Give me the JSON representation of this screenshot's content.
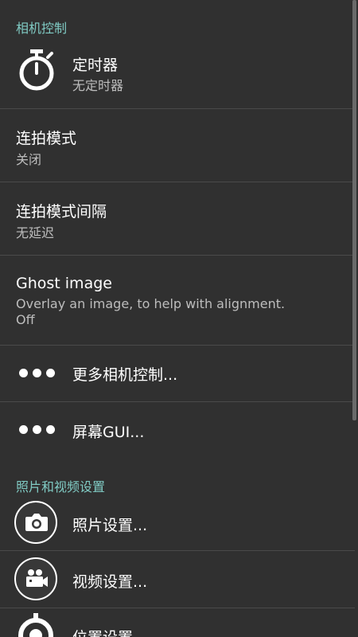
{
  "sections": {
    "camera_controls": "相机控制",
    "photo_video": "照片和视频设置"
  },
  "prefs": {
    "timer": {
      "title": "定时器",
      "summary": "无定时器",
      "icon": "stopwatch-icon"
    },
    "burst_mode": {
      "title": "连拍模式",
      "summary": "关闭"
    },
    "burst_interval": {
      "title": "连拍模式间隔",
      "summary": "无延迟"
    },
    "ghost_image": {
      "title": "Ghost image",
      "summary": "Overlay an image, to help with alignment.",
      "value": "Off"
    },
    "more_camera_controls": {
      "title": "更多相机控制...",
      "icon": "more-dots-icon"
    },
    "screen_gui": {
      "title": "屏幕GUI...",
      "icon": "more-dots-icon"
    },
    "photo_settings": {
      "title": "照片设置...",
      "icon": "camera-icon"
    },
    "video_settings": {
      "title": "视频设置...",
      "icon": "video-camera-icon"
    },
    "location_settings": {
      "title": "位置设置...",
      "icon": "location-icon"
    }
  },
  "colors": {
    "background": "#303030",
    "section_header": "#80cbc4",
    "divider": "#4a4a4a",
    "summary": "#bdbdbd"
  }
}
